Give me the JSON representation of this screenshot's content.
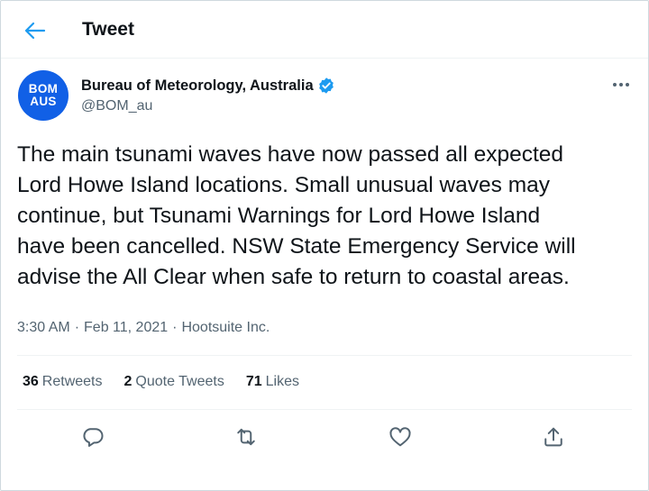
{
  "header": {
    "title": "Tweet"
  },
  "author": {
    "avatar_line1": "BOM",
    "avatar_line2": "AUS",
    "name": "Bureau of Meteorology, Australia",
    "handle": "@BOM_au"
  },
  "tweet": {
    "text": "The main tsunami waves have now passed all expected\nLord Howe Island locations. Small unusual waves may\ncontinue, but Tsunami Warnings for Lord Howe Island\nhave been cancelled. NSW State Emergency Service will\nadvise the All Clear when safe to return to coastal areas.",
    "time": "3:30 AM",
    "date": "Feb 11, 2021",
    "source": "Hootsuite Inc.",
    "separator": "·"
  },
  "stats": {
    "retweets_count": "36",
    "retweets_label": "Retweets",
    "quotes_count": "2",
    "quotes_label": "Quote Tweets",
    "likes_count": "71",
    "likes_label": "Likes"
  },
  "icons": {
    "back": "arrow-left-icon",
    "verified": "verified-badge-icon",
    "more": "more-dots-icon",
    "reply": "reply-icon",
    "retweet": "retweet-icon",
    "like": "heart-icon",
    "share": "share-icon"
  },
  "colors": {
    "accent": "#1d9bf0",
    "avatar_bg": "#1160e6",
    "text": "#0f1419",
    "secondary": "#536471"
  }
}
